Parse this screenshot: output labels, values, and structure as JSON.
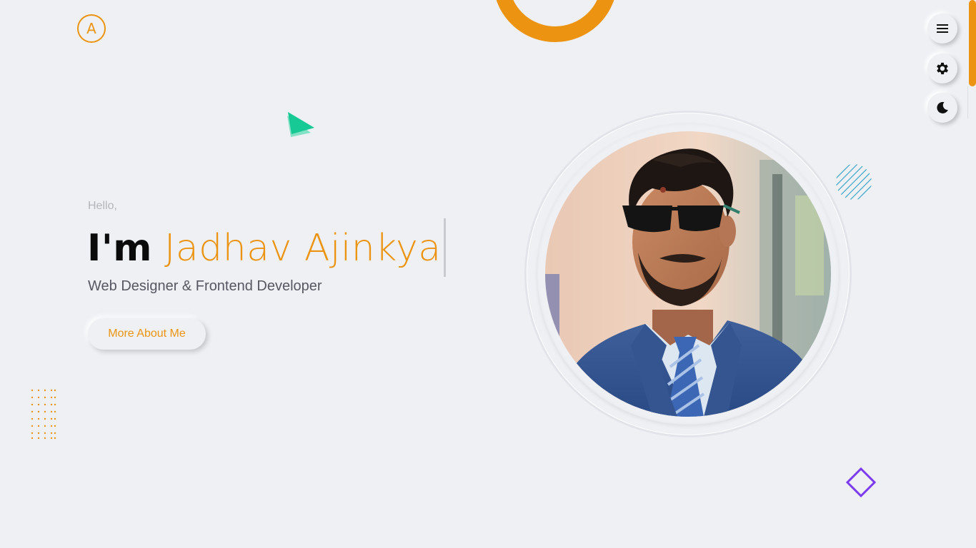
{
  "brand": {
    "logo_letter": "A",
    "accent_color": "#ec9412"
  },
  "hero": {
    "greeting": "Hello,",
    "prefix": "I'm",
    "name": "Jadhav Ajinkya",
    "subtitle": "Web Designer & Frontend Developer",
    "cta_label": "More About Me"
  },
  "profile_photo": {
    "alt": "Portrait of Jadhav Ajinkya"
  },
  "side_nav": {
    "menu_icon": "menu-icon",
    "settings_icon": "gear-icon",
    "theme_icon": "moon-icon"
  },
  "decorations": {
    "triangle_color": "#2ed3a3",
    "stripes_color": "#3aa7c9",
    "diamond_color": "#7c3aed",
    "dots_color": "#ec9412"
  }
}
